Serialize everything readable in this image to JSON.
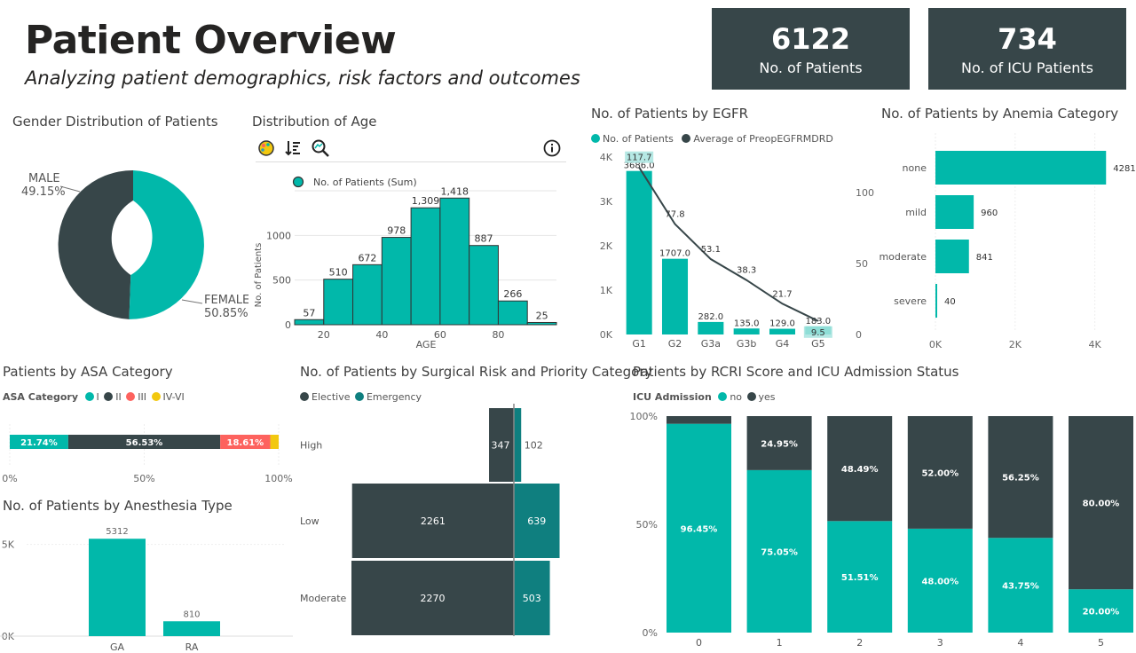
{
  "header": {
    "title": "Patient Overview",
    "subtitle": "Analyzing patient demographics, risk factors and outcomes"
  },
  "kpis": [
    {
      "value": "6122",
      "label": "No. of Patients"
    },
    {
      "value": "734",
      "label": "No. of ICU Patients"
    }
  ],
  "colors": {
    "teal": "#01B8AA",
    "dark": "#374649",
    "red": "#FD625E",
    "yellow": "#F2C80F",
    "darkteal": "#0F7F7F"
  },
  "visual_titles": {
    "gender": "Gender Distribution of Patients",
    "age": "Distribution of Age",
    "egfr": "No. of Patients by EGFR",
    "anemia": "No. of Patients by Anemia Category",
    "asa": "Patients by ASA Category",
    "surgical": "No. of Patients by Surgical Risk and Priority Category",
    "rcri": "Patients by RCRI Score and ICU Admission Status",
    "anesthesia": "No. of Patients by Anesthesia Type"
  },
  "chart_data": [
    {
      "id": "gender",
      "type": "pie",
      "categories": [
        "MALE",
        "FEMALE"
      ],
      "values": [
        49.15,
        50.85
      ],
      "labels": [
        "49.15%",
        "50.85%"
      ]
    },
    {
      "id": "age",
      "type": "bar",
      "legend": "No. of Patients (Sum)",
      "xlabel": "AGE",
      "ylabel": "No. of Patients",
      "bins": [
        [
          10,
          20
        ],
        [
          20,
          30
        ],
        [
          30,
          40
        ],
        [
          40,
          50
        ],
        [
          50,
          60
        ],
        [
          60,
          70
        ],
        [
          70,
          80
        ],
        [
          80,
          90
        ],
        [
          90,
          100
        ]
      ],
      "values": [
        57,
        510,
        672,
        978,
        1309,
        1418,
        887,
        266,
        25
      ],
      "value_labels": [
        "57",
        "510",
        "672",
        "978",
        "1,309",
        "1,418",
        "887",
        "266",
        "25"
      ],
      "xticks": [
        "20",
        "40",
        "60",
        "80"
      ],
      "yticks": [
        "0",
        "500",
        "1000"
      ],
      "xlim": [
        10,
        100
      ],
      "ylim": [
        0,
        1500
      ]
    },
    {
      "id": "egfr",
      "type": "bar",
      "categories": [
        "G1",
        "G2",
        "G3a",
        "G3b",
        "G4",
        "G5"
      ],
      "series": [
        {
          "name": "No. of Patients",
          "values": [
            3686,
            1707,
            282,
            135,
            129,
            183
          ],
          "labels": [
            "3686.0",
            "1707.0",
            "282.0",
            "135.0",
            "129.0",
            "183.0"
          ]
        },
        {
          "name": "Average of PreopEGFRMDRD",
          "values": [
            117.7,
            77.8,
            53.1,
            38.3,
            21.7,
            9.5
          ],
          "labels": [
            "117.7",
            "77.8",
            "53.1",
            "38.3",
            "21.7",
            "9.5"
          ]
        }
      ],
      "yticks_left": [
        "0K",
        "1K",
        "2K",
        "3K",
        "4K"
      ],
      "yticks_right": [
        "0",
        "50",
        "100"
      ],
      "ylim": [
        0,
        4000
      ],
      "y2lim": [
        0,
        125
      ]
    },
    {
      "id": "anemia",
      "type": "bar",
      "categories": [
        "none",
        "mild",
        "moderate",
        "severe"
      ],
      "values": [
        4281,
        960,
        841,
        40
      ],
      "xticks": [
        "0K",
        "2K",
        "4K"
      ],
      "xlim": [
        0,
        5000
      ]
    },
    {
      "id": "asa",
      "type": "bar",
      "legend_title": "ASA Category",
      "categories": [
        "I",
        "II",
        "III",
        "IV-VI"
      ],
      "values": [
        21.74,
        56.53,
        18.61,
        3.12
      ],
      "labels": [
        "21.74%",
        "56.53%",
        "18.61%",
        ""
      ],
      "xticks": [
        "0%",
        "50%",
        "100%"
      ]
    },
    {
      "id": "anesthesia",
      "type": "bar",
      "categories": [
        "GA",
        "RA"
      ],
      "values": [
        5312,
        810
      ],
      "yticks": [
        "0K",
        "5K"
      ],
      "ylim": [
        0,
        6000
      ]
    },
    {
      "id": "surgical",
      "type": "bar",
      "categories": [
        "High",
        "Low",
        "Moderate"
      ],
      "series": [
        {
          "name": "Elective",
          "values": [
            347,
            2261,
            2270
          ]
        },
        {
          "name": "Emergency",
          "values": [
            102,
            639,
            503
          ]
        }
      ]
    },
    {
      "id": "rcri",
      "type": "bar",
      "legend_title": "ICU Admission",
      "categories": [
        "0",
        "1",
        "2",
        "3",
        "4",
        "5"
      ],
      "series": [
        {
          "name": "no",
          "values": [
            96.45,
            75.05,
            51.51,
            48.0,
            43.75,
            20.0
          ],
          "labels": [
            "96.45%",
            "75.05%",
            "51.51%",
            "48.00%",
            "43.75%",
            "20.00%"
          ]
        },
        {
          "name": "yes",
          "values": [
            3.55,
            24.95,
            48.49,
            52.0,
            56.25,
            80.0
          ],
          "labels": [
            "",
            "24.95%",
            "48.49%",
            "52.00%",
            "56.25%",
            "80.00%"
          ]
        }
      ],
      "yticks": [
        "0%",
        "50%",
        "100%"
      ]
    }
  ]
}
